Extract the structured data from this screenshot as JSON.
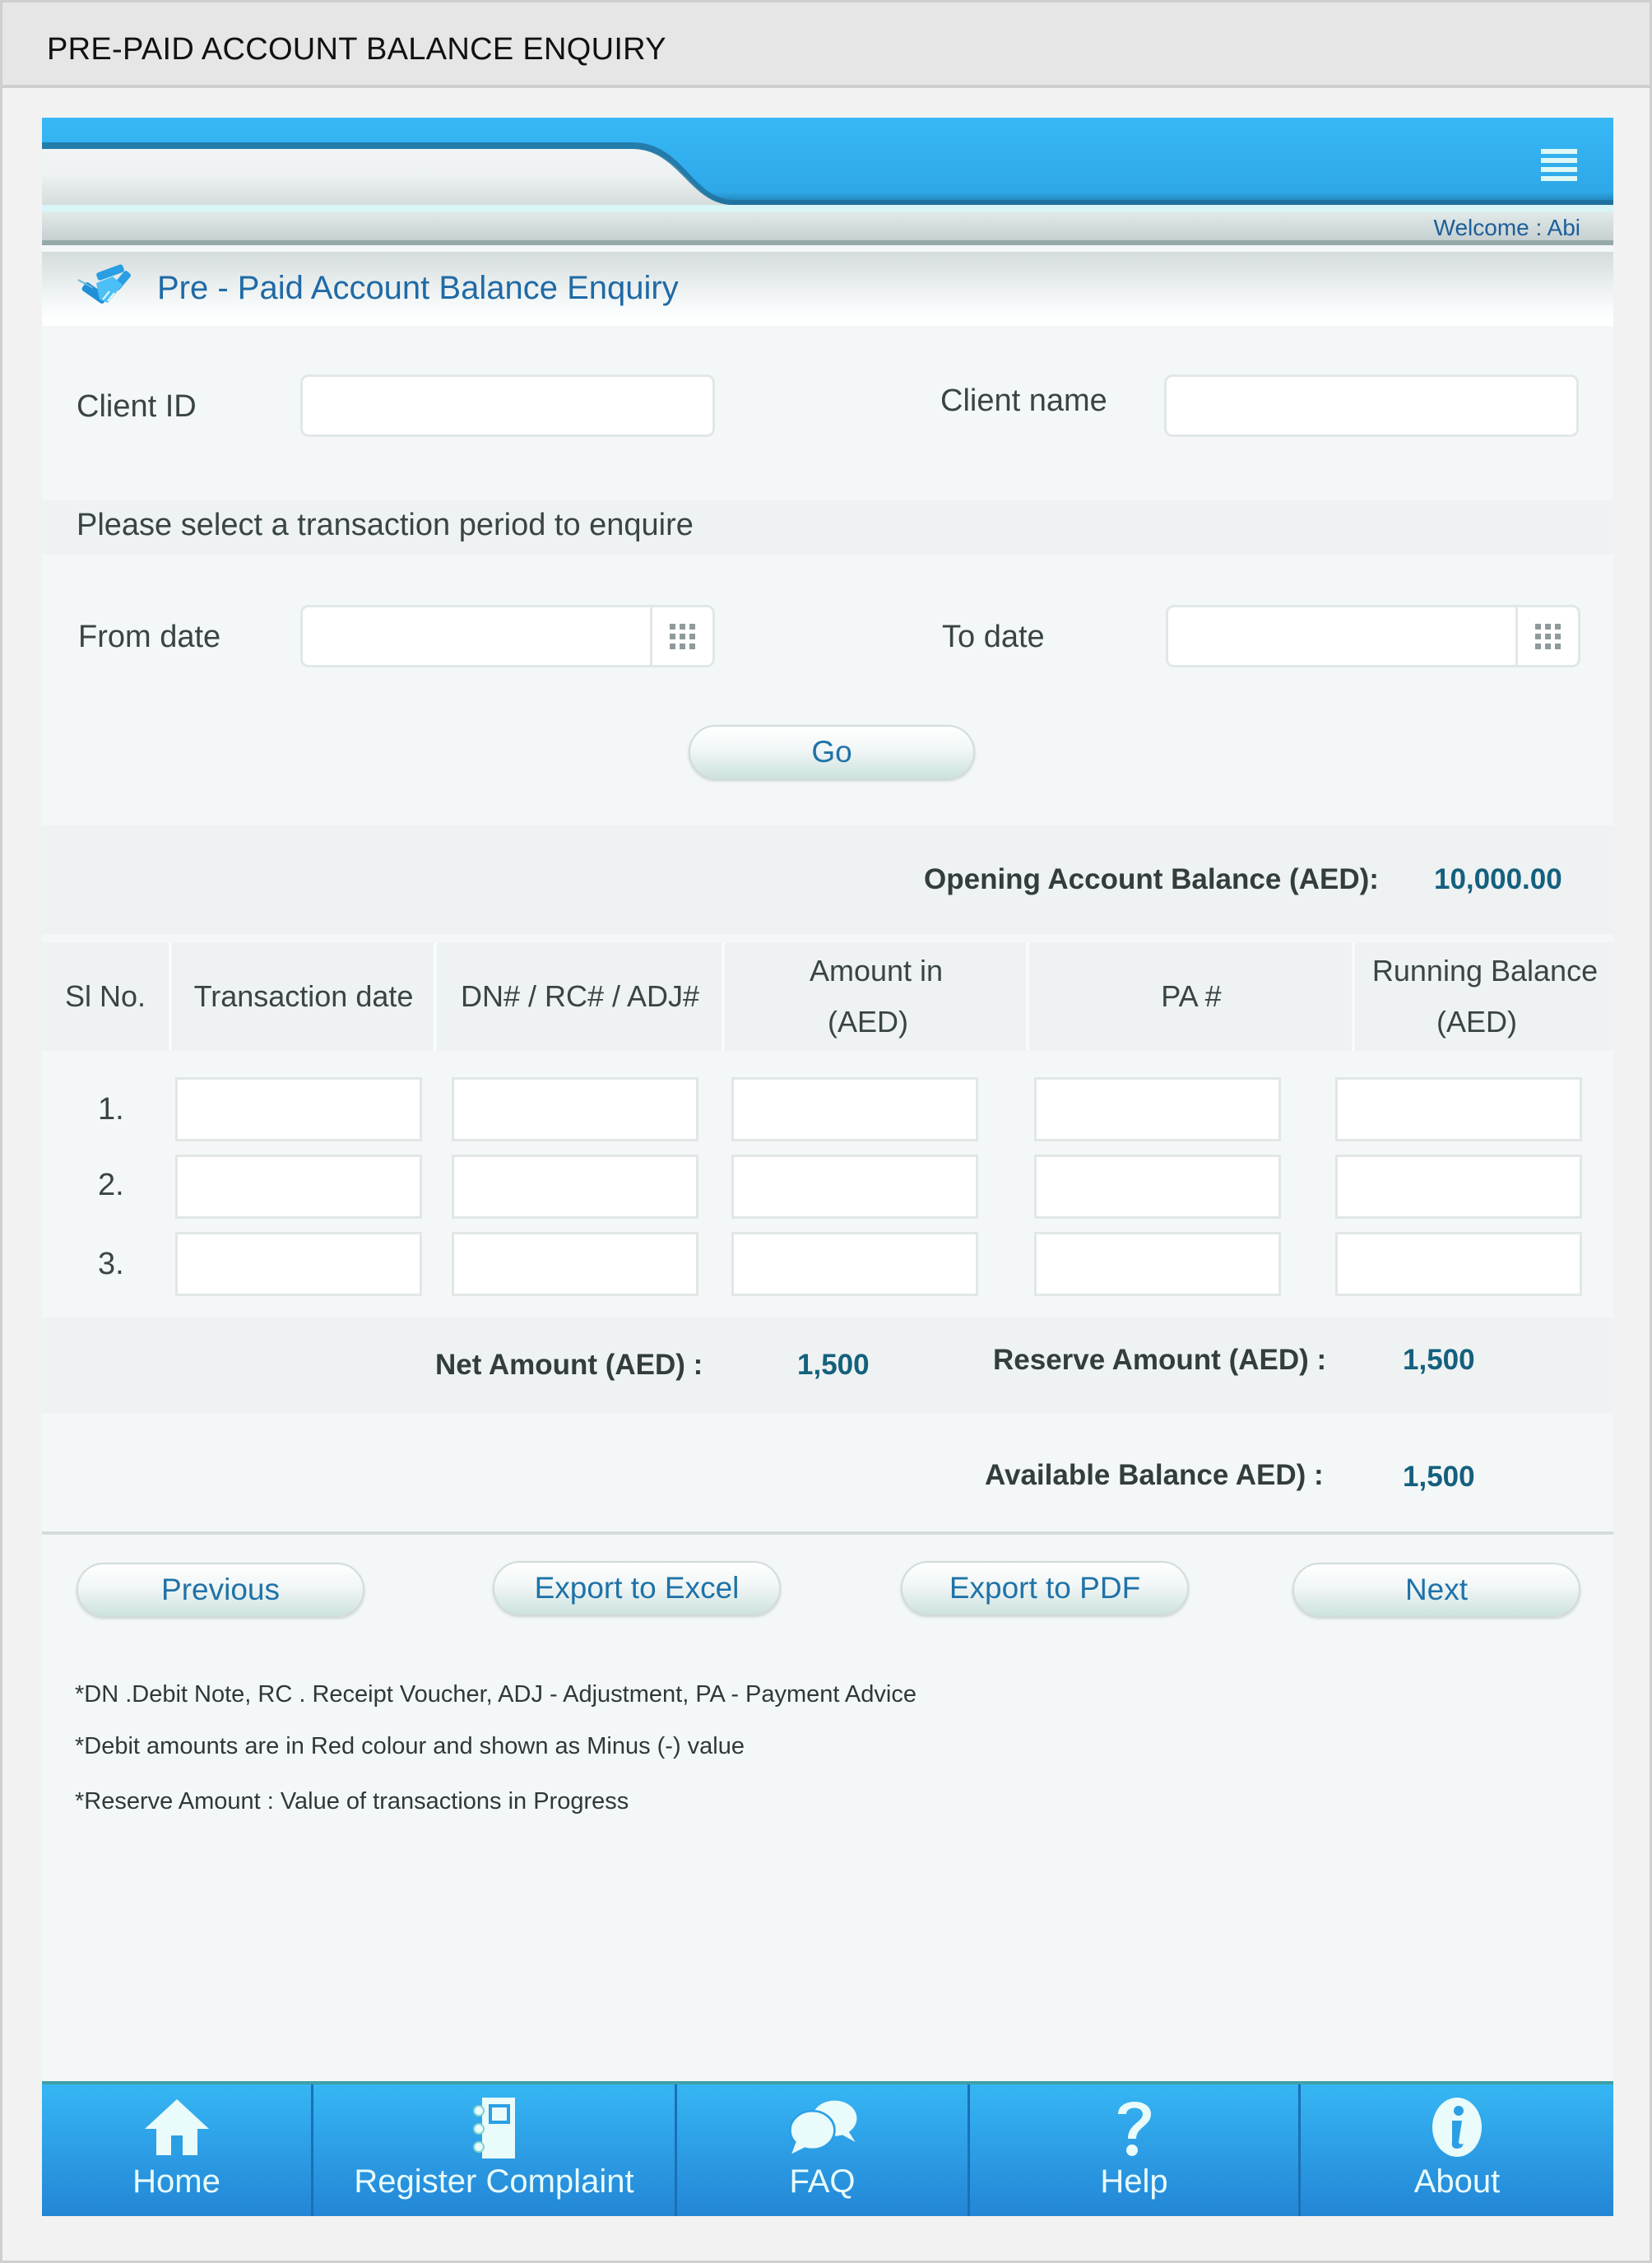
{
  "document_title": "PRE-PAID ACCOUNT BALANCE ENQUIRY",
  "header": {
    "welcome_text": "Welcome : Abi",
    "menu_icon": "hamburger-menu-icon"
  },
  "page": {
    "title": "Pre - Paid Account Balance Enquiry",
    "title_icon": "handshake-icon"
  },
  "form": {
    "client_id_label": "Client ID",
    "client_id_value": "",
    "client_name_label": "Client name",
    "client_name_value": "",
    "period_prompt": "Please select a transaction period to enquire",
    "from_date_label": "From date",
    "from_date_value": "",
    "to_date_label": "To date",
    "to_date_value": "",
    "calendar_icon": "calendar-grid-icon",
    "go_label": "Go"
  },
  "opening_balance": {
    "label": "Opening Account Balance (AED):",
    "value": "10,000.00"
  },
  "table": {
    "headers": [
      "Sl No.",
      "Transaction date",
      "DN# / RC# / ADJ#",
      "Amount in\n(AED)",
      "PA #",
      "Running Balance\n(AED)"
    ],
    "header_lines": {
      "amount": [
        "Amount in",
        "(AED)"
      ],
      "running": [
        "Running Balance",
        "(AED)"
      ]
    },
    "rows": [
      {
        "sl": "1.",
        "transaction_date": "",
        "reference": "",
        "amount": "",
        "pa": "",
        "running_balance": ""
      },
      {
        "sl": "2.",
        "transaction_date": "",
        "reference": "",
        "amount": "",
        "pa": "",
        "running_balance": ""
      },
      {
        "sl": "3.",
        "transaction_date": "",
        "reference": "",
        "amount": "",
        "pa": "",
        "running_balance": ""
      }
    ]
  },
  "totals": {
    "net_amount_label": "Net  Amount  (AED) :",
    "net_amount_value": "1,500",
    "reserve_amount_label": "Reserve Amount (AED) :",
    "reserve_amount_value": "1,500",
    "available_balance_label": "Available Balance AED) :",
    "available_balance_value": "1,500"
  },
  "actions": {
    "previous": "Previous",
    "export_excel": "Export to Excel",
    "export_pdf": "Export to PDF",
    "next": "Next"
  },
  "notes": [
    "*DN .Debit Note, RC . Receipt Voucher, ADJ - Adjustment, PA - Payment Advice",
    "*Debit amounts are in Red colour and shown as Minus (-) value",
    "*Reserve Amount : Value of transactions in Progress"
  ],
  "footer_nav": [
    {
      "label": "Home",
      "icon": "home-icon"
    },
    {
      "label": "Register Complaint",
      "icon": "notebook-icon"
    },
    {
      "label": "FAQ",
      "icon": "chat-bubbles-icon"
    },
    {
      "label": "Help",
      "icon": "question-mark-icon"
    },
    {
      "label": "About",
      "icon": "info-icon"
    }
  ],
  "colors": {
    "brand_blue": "#36b6f4",
    "value_teal": "#14607e",
    "link_blue": "#1f72a8"
  }
}
